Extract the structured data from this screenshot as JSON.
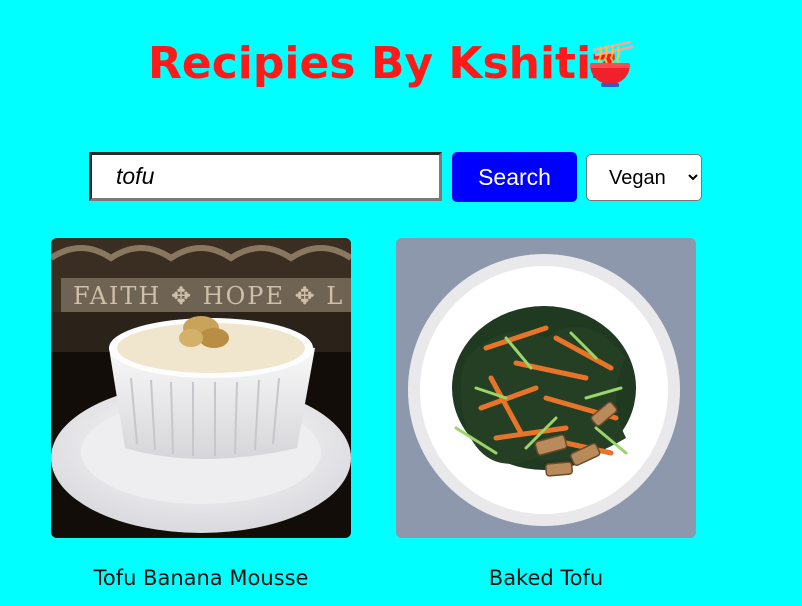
{
  "header": {
    "title": "Recipies By Kshitiz",
    "icon": "noodle-bowl-icon"
  },
  "search": {
    "value": "tofu",
    "button_label": "Search",
    "diet_selected": "Vegan"
  },
  "colors": {
    "background": "#00FFFF",
    "title": "#FF1A1A",
    "button": "#0000FF"
  },
  "recipes": [
    {
      "title": "Tofu Banana Mousse",
      "image": "tofu-banana-mousse-photo"
    },
    {
      "title": "Baked Tofu",
      "image": "baked-tofu-salad-photo"
    }
  ]
}
